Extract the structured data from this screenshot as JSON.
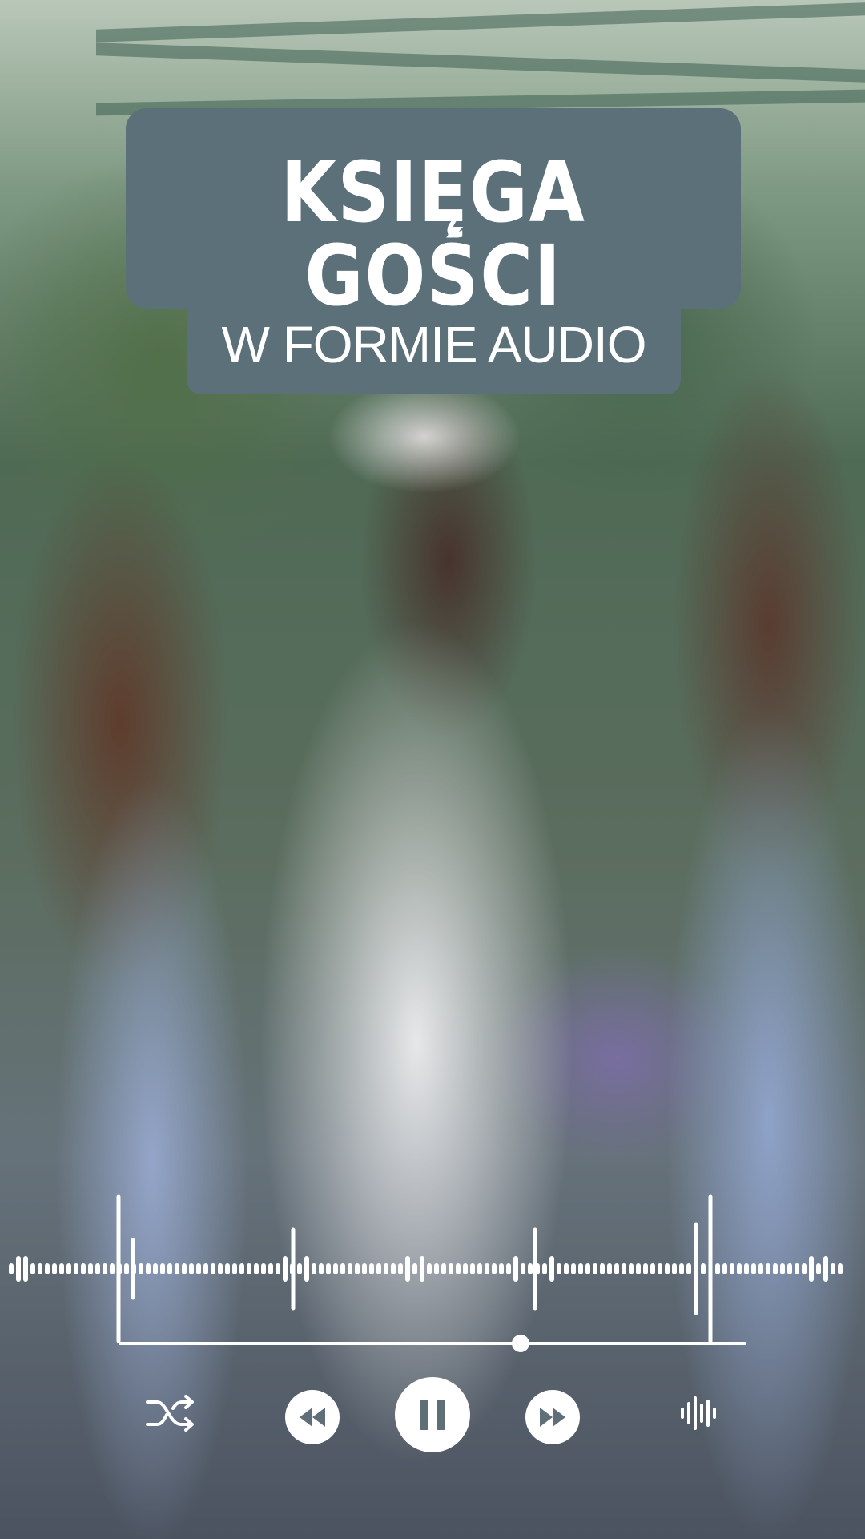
{
  "title": {
    "main": "KSIĘGA GOŚCI",
    "subtitle": "W FORMIE AUDIO",
    "card_color": "#5b7079",
    "text_color": "#ffffff"
  },
  "player": {
    "progress": 0.64,
    "controls": [
      {
        "id": "shuffle",
        "icon": "shuffle-icon"
      },
      {
        "id": "rewind",
        "icon": "rewind-icon"
      },
      {
        "id": "pause",
        "icon": "pause-icon"
      },
      {
        "id": "forward",
        "icon": "fast-forward-icon"
      },
      {
        "id": "soundwave",
        "icon": "soundwave-icon"
      }
    ],
    "accent_color": "#ffffff"
  }
}
